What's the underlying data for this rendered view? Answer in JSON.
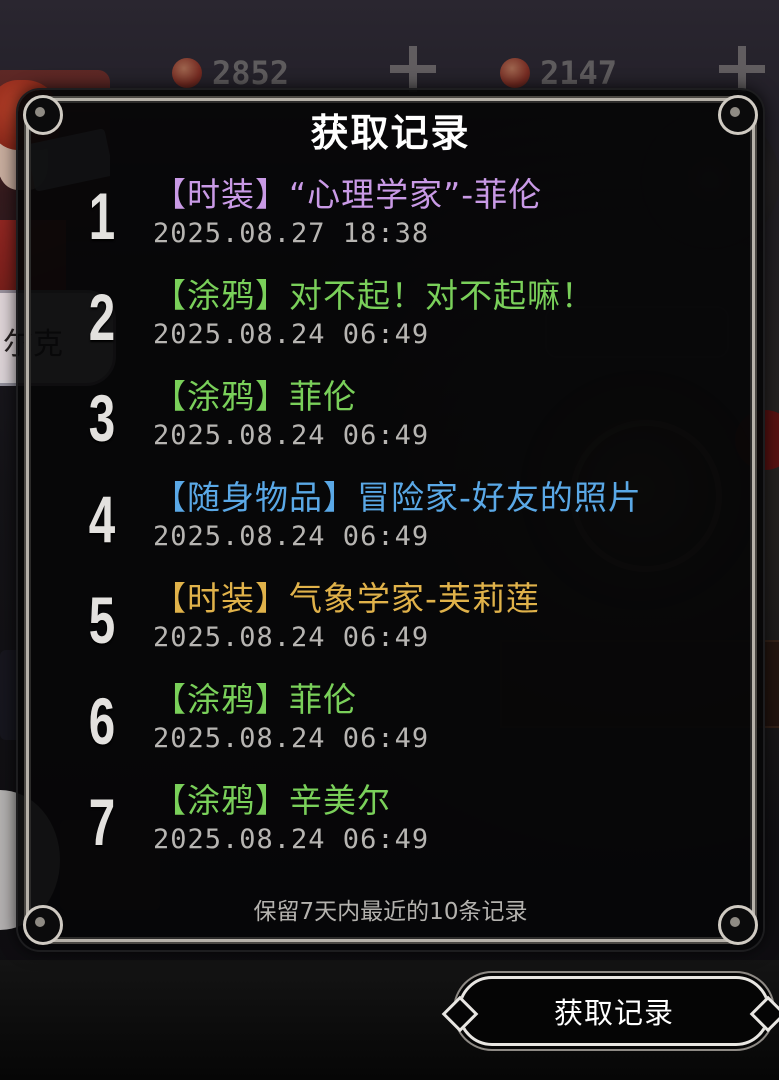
{
  "background": {
    "currency_1": {
      "value": "2852",
      "icon": "coin-icon"
    },
    "currency_2": {
      "value": "2147",
      "icon": "ruby-icon"
    },
    "character_name_fragment": "尔克"
  },
  "panel": {
    "title": "获取记录",
    "records": [
      {
        "rank": "1",
        "text": "【时装】“心理学家”-菲伦",
        "time": "2025.08.27 18:38",
        "color": "#c99ae6"
      },
      {
        "rank": "2",
        "text": "【涂鸦】对不起！对不起嘛！",
        "time": "2025.08.24 06:49",
        "color": "#7ad05a"
      },
      {
        "rank": "3",
        "text": "【涂鸦】菲伦",
        "time": "2025.08.24 06:49",
        "color": "#7ad05a"
      },
      {
        "rank": "4",
        "text": "【随身物品】冒险家-好友的照片",
        "time": "2025.08.24 06:49",
        "color": "#5aa8e6"
      },
      {
        "rank": "5",
        "text": "【时装】气象学家-芙莉莲",
        "time": "2025.08.24 06:49",
        "color": "#e0b24a"
      },
      {
        "rank": "6",
        "text": "【涂鸦】菲伦",
        "time": "2025.08.24 06:49",
        "color": "#7ad05a"
      },
      {
        "rank": "7",
        "text": "【涂鸦】辛美尔",
        "time": "2025.08.24 06:49",
        "color": "#7ad05a"
      }
    ],
    "footer_note": "保留7天内最近的10条记录"
  },
  "bottom_button": {
    "label": "获取记录"
  }
}
